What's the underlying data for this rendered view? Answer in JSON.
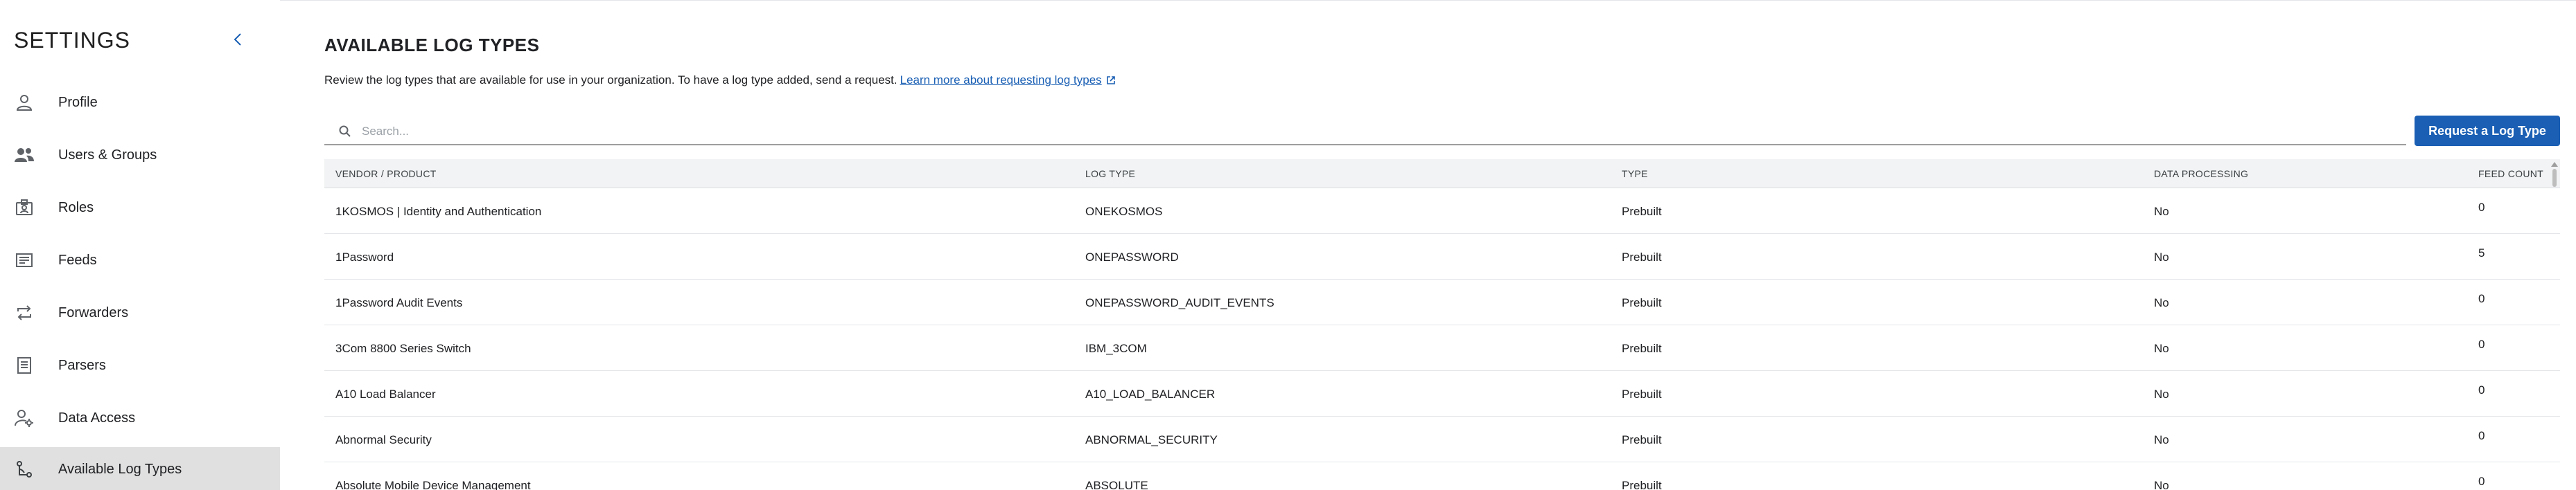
{
  "sidebar": {
    "title": "SETTINGS",
    "items": [
      {
        "label": "Profile",
        "icon": "person-icon",
        "active": false
      },
      {
        "label": "Users & Groups",
        "icon": "users-icon",
        "active": false
      },
      {
        "label": "Roles",
        "icon": "roles-badge-icon",
        "active": false
      },
      {
        "label": "Feeds",
        "icon": "feeds-icon",
        "active": false
      },
      {
        "label": "Forwarders",
        "icon": "forward-arrows-icon",
        "active": false
      },
      {
        "label": "Parsers",
        "icon": "document-list-icon",
        "active": false
      },
      {
        "label": "Data Access",
        "icon": "user-gear-icon",
        "active": false
      },
      {
        "label": "Available Log Types",
        "icon": "branch-icon",
        "active": true
      }
    ]
  },
  "main": {
    "title": "AVAILABLE LOG TYPES",
    "description": "Review the log types that are available for use in your organization. To have a log type added, send a request.",
    "learn_more_link": "Learn more about requesting log types",
    "search": {
      "placeholder": "Search...",
      "value": ""
    },
    "request_button": "Request a Log Type",
    "table": {
      "headers": {
        "vendor": "VENDOR / PRODUCT",
        "log_type": "LOG TYPE",
        "type": "TYPE",
        "data_processing": "DATA PROCESSING",
        "feed_count": "FEED COUNT"
      },
      "rows": [
        {
          "vendor": "1KOSMOS | Identity and Authentication",
          "log_type": "ONEKOSMOS",
          "type": "Prebuilt",
          "data_processing": "No",
          "feed_count": "0"
        },
        {
          "vendor": "1Password",
          "log_type": "ONEPASSWORD",
          "type": "Prebuilt",
          "data_processing": "No",
          "feed_count": "5"
        },
        {
          "vendor": "1Password Audit Events",
          "log_type": "ONEPASSWORD_AUDIT_EVENTS",
          "type": "Prebuilt",
          "data_processing": "No",
          "feed_count": "0"
        },
        {
          "vendor": "3Com 8800 Series Switch",
          "log_type": "IBM_3COM",
          "type": "Prebuilt",
          "data_processing": "No",
          "feed_count": "0"
        },
        {
          "vendor": "A10 Load Balancer",
          "log_type": "A10_LOAD_BALANCER",
          "type": "Prebuilt",
          "data_processing": "No",
          "feed_count": "0"
        },
        {
          "vendor": "Abnormal Security",
          "log_type": "ABNORMAL_SECURITY",
          "type": "Prebuilt",
          "data_processing": "No",
          "feed_count": "0"
        },
        {
          "vendor": "Absolute Mobile Device Management",
          "log_type": "ABSOLUTE",
          "type": "Prebuilt",
          "data_processing": "No",
          "feed_count": "0"
        }
      ]
    }
  },
  "colors": {
    "accent": "#1a5fb4",
    "active_nav_bg": "#e0e0e0",
    "icon": "#5f6368"
  }
}
